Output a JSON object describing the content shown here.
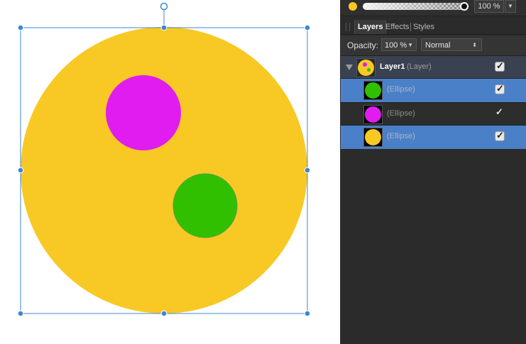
{
  "colors": {
    "yellow": "#f8c924",
    "magenta": "#e01cf0",
    "green": "#31c000",
    "selection": "#4a80c8",
    "handle": "#3f86d6"
  },
  "canvas": {
    "shapes": [
      "large-yellow-ellipse",
      "magenta-ellipse",
      "green-ellipse"
    ],
    "selection_handles": 9
  },
  "fill_panel": {
    "color_icon": "yellow-color-dot",
    "opacity_value": "100 %",
    "dropdown_icon": "▼"
  },
  "tabs": [
    "Layers",
    "Effects",
    "Styles"
  ],
  "layers_panel": {
    "opacity_label": "Opacity:",
    "opacity_value": "100 %",
    "blend_mode": "Normal",
    "parent": {
      "name": "Layer1",
      "type": "(Layer)"
    },
    "children": [
      {
        "label": "(Ellipse)",
        "color": "#31c000",
        "selected": true
      },
      {
        "label": "(Ellipse)",
        "color": "#e01cf0",
        "selected": false
      },
      {
        "label": "(Ellipse)",
        "color": "#f8c924",
        "selected": true
      }
    ]
  }
}
